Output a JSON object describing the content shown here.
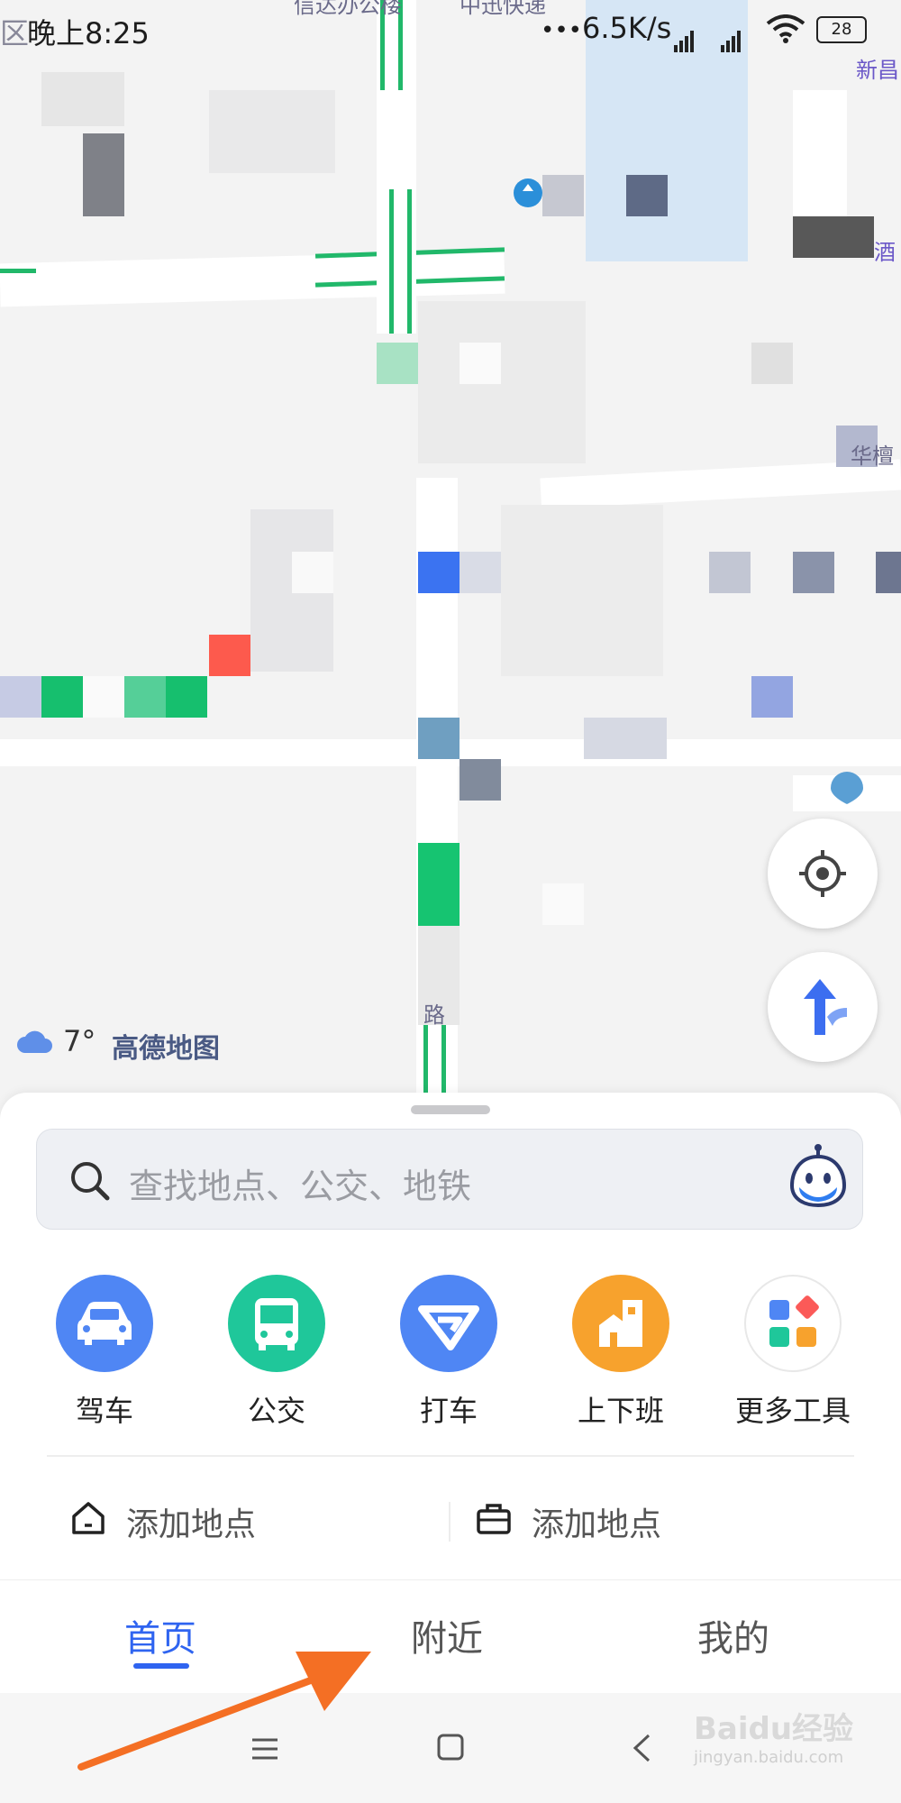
{
  "status_bar": {
    "time": "晚上8:25",
    "network_speed": "6.5K/s",
    "battery": "28"
  },
  "map": {
    "labels": [
      "信达办公楼",
      "中迅快递",
      "新昌",
      "酒",
      "华檀",
      "路"
    ],
    "provider": "高德地图",
    "colors": {
      "road_green": "#21b86a",
      "accent_blue": "#2f6cf5"
    }
  },
  "weather": {
    "icon": "cloud-icon",
    "temperature": "7°"
  },
  "map_controls": {
    "locate_icon": "crosshair-icon",
    "navigate_icon": "turn-arrow-icon"
  },
  "search": {
    "placeholder": "查找地点、公交、地铁",
    "voice_icon": "assistant-bot-icon"
  },
  "tools": [
    {
      "label": "驾车",
      "icon": "car-icon",
      "color": "#4f86f4"
    },
    {
      "label": "公交",
      "icon": "bus-icon",
      "color": "#1fc79a"
    },
    {
      "label": "打车",
      "icon": "taxi-icon",
      "color": "#4f86f4"
    },
    {
      "label": "上下班",
      "icon": "commute-icon",
      "color": "#f7a22d"
    },
    {
      "label": "更多工具",
      "icon": "grid-icon",
      "color": "#ffffff"
    }
  ],
  "shortcuts": [
    {
      "label": "添加地点",
      "icon": "home-icon"
    },
    {
      "label": "添加地点",
      "icon": "briefcase-icon"
    }
  ],
  "tabs": [
    {
      "label": "首页",
      "active": true
    },
    {
      "label": "附近",
      "active": false
    },
    {
      "label": "我的",
      "active": false
    }
  ],
  "watermark": {
    "text": "Baidu经验",
    "sub": "jingyan.baidu.com"
  }
}
